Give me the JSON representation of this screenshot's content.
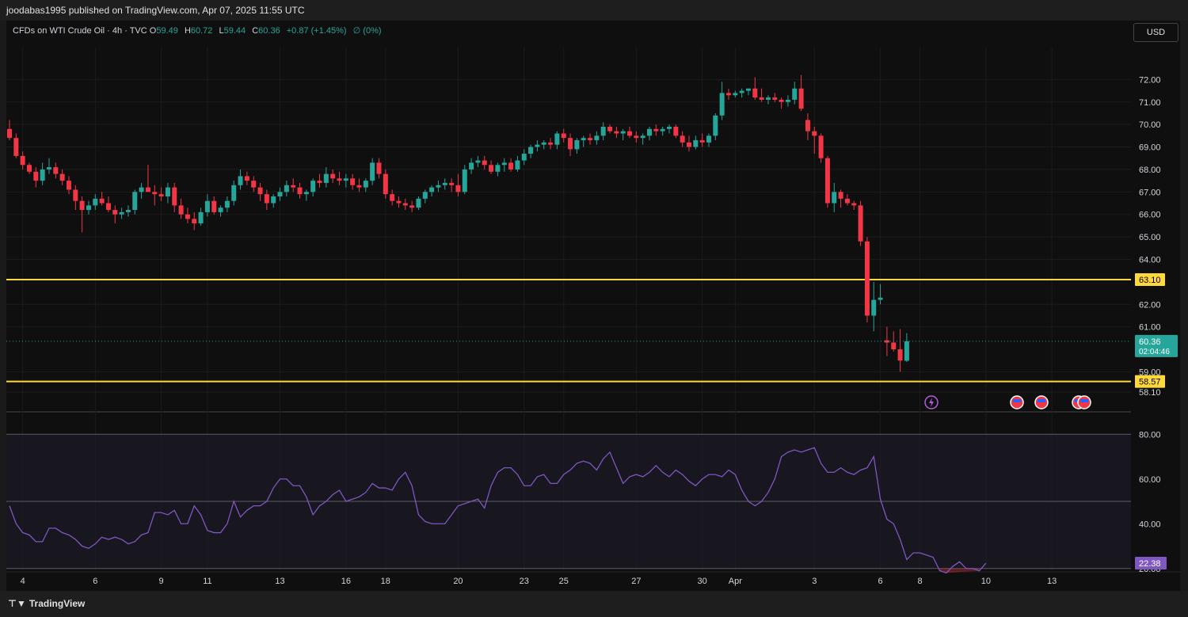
{
  "header": {
    "publisher_text": "joodabas1995 published on TradingView.com, Apr 07, 2025 11:55 UTC"
  },
  "legend": {
    "symbol": "CFDs on WTI Crude Oil · 4h · TVC",
    "open_label": "O",
    "open": "59.49",
    "high_label": "H",
    "high": "60.72",
    "low_label": "L",
    "low": "59.44",
    "close_label": "C",
    "close": "60.36",
    "change": "+0.87 (+1.45%)",
    "extra": "∅ (0%)"
  },
  "currency_button": "USD",
  "footer": {
    "brand": "TradingView",
    "logo_icon": "tradingview-logo-icon"
  },
  "colors": {
    "up": "#26a69a",
    "down": "#f23645",
    "level": "#ffd93b",
    "rsi": "#7e57c2",
    "background": "#0f0f0f"
  },
  "chart_data": [
    {
      "type": "candlestick",
      "symbol": "CFDs on WTI Crude Oil",
      "interval": "4h",
      "ylim": [
        57.5,
        73.0
      ],
      "y_ticks": [
        "72.00",
        "71.00",
        "70.00",
        "69.00",
        "68.00",
        "67.00",
        "66.00",
        "65.00",
        "64.00",
        "62.00",
        "61.00",
        "59.00",
        "58.10"
      ],
      "x_ticks": [
        {
          "label": "4",
          "i": 2
        },
        {
          "label": "6",
          "i": 13
        },
        {
          "label": "9",
          "i": 23
        },
        {
          "label": "11",
          "i": 30
        },
        {
          "label": "13",
          "i": 41
        },
        {
          "label": "16",
          "i": 51
        },
        {
          "label": "18",
          "i": 57
        },
        {
          "label": "20",
          "i": 68
        },
        {
          "label": "23",
          "i": 78
        },
        {
          "label": "25",
          "i": 84
        },
        {
          "label": "27",
          "i": 95
        },
        {
          "label": "30",
          "i": 105
        },
        {
          "label": "Apr",
          "i": 110
        },
        {
          "label": "3",
          "i": 122
        },
        {
          "label": "6",
          "i": 132
        },
        {
          "label": "8",
          "i": 138
        },
        {
          "label": "10",
          "i": 148
        },
        {
          "label": "13",
          "i": 158
        }
      ],
      "horizontal_levels": [
        {
          "value": 63.1,
          "label": "63.10"
        },
        {
          "value": 58.57,
          "label": "58.57"
        }
      ],
      "last_price": {
        "value": 60.36,
        "label": "60.36",
        "countdown": "02:04:46"
      },
      "candles": [
        [
          69.8,
          70.2,
          69.3,
          69.4
        ],
        [
          69.4,
          69.6,
          68.5,
          68.6
        ],
        [
          68.6,
          68.8,
          68.0,
          68.2
        ],
        [
          68.2,
          68.3,
          67.8,
          67.9
        ],
        [
          67.9,
          68.1,
          67.2,
          67.5
        ],
        [
          67.5,
          68.3,
          67.3,
          68.0
        ],
        [
          68.0,
          68.5,
          67.8,
          68.1
        ],
        [
          68.1,
          68.3,
          67.6,
          67.8
        ],
        [
          67.8,
          68.0,
          67.3,
          67.5
        ],
        [
          67.5,
          67.7,
          66.9,
          67.1
        ],
        [
          67.1,
          67.3,
          66.2,
          66.6
        ],
        [
          66.6,
          66.8,
          65.2,
          66.2
        ],
        [
          66.2,
          66.6,
          66.0,
          66.4
        ],
        [
          66.4,
          66.9,
          66.2,
          66.7
        ],
        [
          66.7,
          67.0,
          66.4,
          66.5
        ],
        [
          66.5,
          66.8,
          66.1,
          66.2
        ],
        [
          66.2,
          66.4,
          65.6,
          66.0
        ],
        [
          66.0,
          66.3,
          65.8,
          66.1
        ],
        [
          66.1,
          66.4,
          65.9,
          66.2
        ],
        [
          66.2,
          67.1,
          66.0,
          67.0
        ],
        [
          67.0,
          67.4,
          66.7,
          67.2
        ],
        [
          67.2,
          68.2,
          67.0,
          67.0
        ],
        [
          67.0,
          67.3,
          66.4,
          66.9
        ],
        [
          66.9,
          67.2,
          66.6,
          66.8
        ],
        [
          66.8,
          67.4,
          66.5,
          67.2
        ],
        [
          67.2,
          67.4,
          66.1,
          66.4
        ],
        [
          66.4,
          66.7,
          65.8,
          66.0
        ],
        [
          66.0,
          66.3,
          65.6,
          65.8
        ],
        [
          65.8,
          66.1,
          65.3,
          65.6
        ],
        [
          65.6,
          66.3,
          65.5,
          66.1
        ],
        [
          66.1,
          66.9,
          65.9,
          66.6
        ],
        [
          66.6,
          66.8,
          66.0,
          66.1
        ],
        [
          66.1,
          66.4,
          65.9,
          66.3
        ],
        [
          66.3,
          66.8,
          66.1,
          66.6
        ],
        [
          66.6,
          67.5,
          66.4,
          67.3
        ],
        [
          67.3,
          68.0,
          67.1,
          67.7
        ],
        [
          67.7,
          67.9,
          67.3,
          67.5
        ],
        [
          67.5,
          67.7,
          67.0,
          67.2
        ],
        [
          67.2,
          67.4,
          66.6,
          66.9
        ],
        [
          66.9,
          67.1,
          66.2,
          66.5
        ],
        [
          66.5,
          66.9,
          66.3,
          66.8
        ],
        [
          66.8,
          67.2,
          66.6,
          67.0
        ],
        [
          67.0,
          67.5,
          66.8,
          67.3
        ],
        [
          67.3,
          67.6,
          67.0,
          67.2
        ],
        [
          67.2,
          67.4,
          66.7,
          66.9
        ],
        [
          66.9,
          67.1,
          66.6,
          67.0
        ],
        [
          67.0,
          67.6,
          66.8,
          67.5
        ],
        [
          67.5,
          67.8,
          67.2,
          67.4
        ],
        [
          67.4,
          68.1,
          67.2,
          67.8
        ],
        [
          67.8,
          68.0,
          67.4,
          67.6
        ],
        [
          67.6,
          67.9,
          67.3,
          67.5
        ],
        [
          67.5,
          67.8,
          67.2,
          67.6
        ],
        [
          67.6,
          67.8,
          67.1,
          67.3
        ],
        [
          67.3,
          67.6,
          67.0,
          67.2
        ],
        [
          67.2,
          67.6,
          67.0,
          67.5
        ],
        [
          67.5,
          68.5,
          67.3,
          68.3
        ],
        [
          68.3,
          68.5,
          67.6,
          67.8
        ],
        [
          67.8,
          68.0,
          66.7,
          66.9
        ],
        [
          66.9,
          67.1,
          66.4,
          66.6
        ],
        [
          66.6,
          66.8,
          66.3,
          66.5
        ],
        [
          66.5,
          66.7,
          66.2,
          66.4
        ],
        [
          66.4,
          66.6,
          66.1,
          66.3
        ],
        [
          66.3,
          66.8,
          66.2,
          66.7
        ],
        [
          66.7,
          67.1,
          66.5,
          67.0
        ],
        [
          67.0,
          67.3,
          66.8,
          67.2
        ],
        [
          67.2,
          67.5,
          67.0,
          67.3
        ],
        [
          67.3,
          67.6,
          67.1,
          67.4
        ],
        [
          67.4,
          67.6,
          67.0,
          67.3
        ],
        [
          67.3,
          67.8,
          66.8,
          67.0
        ],
        [
          67.0,
          68.2,
          66.9,
          68.0
        ],
        [
          68.0,
          68.5,
          67.8,
          68.3
        ],
        [
          68.3,
          68.6,
          68.1,
          68.4
        ],
        [
          68.4,
          68.6,
          68.0,
          68.2
        ],
        [
          68.2,
          68.4,
          67.8,
          67.9
        ],
        [
          67.9,
          68.3,
          67.7,
          68.2
        ],
        [
          68.2,
          68.5,
          67.9,
          68.3
        ],
        [
          68.3,
          68.5,
          67.9,
          68.0
        ],
        [
          68.0,
          68.6,
          67.9,
          68.4
        ],
        [
          68.4,
          68.9,
          68.2,
          68.7
        ],
        [
          68.7,
          69.1,
          68.5,
          69.0
        ],
        [
          69.0,
          69.3,
          68.8,
          69.1
        ],
        [
          69.1,
          69.3,
          68.9,
          69.2
        ],
        [
          69.2,
          69.4,
          68.9,
          69.1
        ],
        [
          69.1,
          69.7,
          68.9,
          69.6
        ],
        [
          69.6,
          69.8,
          69.2,
          69.4
        ],
        [
          69.4,
          69.6,
          68.6,
          68.9
        ],
        [
          68.9,
          69.4,
          68.7,
          69.3
        ],
        [
          69.3,
          69.5,
          69.0,
          69.4
        ],
        [
          69.4,
          69.6,
          69.1,
          69.3
        ],
        [
          69.3,
          69.7,
          69.1,
          69.5
        ],
        [
          69.5,
          70.1,
          69.3,
          69.9
        ],
        [
          69.9,
          70.0,
          69.6,
          69.7
        ],
        [
          69.7,
          69.9,
          69.4,
          69.6
        ],
        [
          69.6,
          69.8,
          69.3,
          69.7
        ],
        [
          69.7,
          69.9,
          69.4,
          69.5
        ],
        [
          69.5,
          69.7,
          69.2,
          69.4
        ],
        [
          69.4,
          69.6,
          69.1,
          69.5
        ],
        [
          69.5,
          69.9,
          69.3,
          69.8
        ],
        [
          69.8,
          70.0,
          69.5,
          69.7
        ],
        [
          69.7,
          69.9,
          69.5,
          69.8
        ],
        [
          69.8,
          70.0,
          69.6,
          69.9
        ],
        [
          69.9,
          70.0,
          69.4,
          69.5
        ],
        [
          69.5,
          69.7,
          69.0,
          69.2
        ],
        [
          69.2,
          69.5,
          68.8,
          69.0
        ],
        [
          69.0,
          69.5,
          68.9,
          69.3
        ],
        [
          69.3,
          69.6,
          69.0,
          69.2
        ],
        [
          69.2,
          69.6,
          69.0,
          69.5
        ],
        [
          69.5,
          70.5,
          69.3,
          70.4
        ],
        [
          70.4,
          71.9,
          70.2,
          71.4
        ],
        [
          71.4,
          71.6,
          71.1,
          71.3
        ],
        [
          71.3,
          71.5,
          71.2,
          71.4
        ],
        [
          71.4,
          71.6,
          71.2,
          71.5
        ],
        [
          71.5,
          71.6,
          71.3,
          71.6
        ],
        [
          71.6,
          72.1,
          71.1,
          71.2
        ],
        [
          71.2,
          71.6,
          71.0,
          71.1
        ],
        [
          71.1,
          71.3,
          70.9,
          71.2
        ],
        [
          71.2,
          71.4,
          71.0,
          71.1
        ],
        [
          71.1,
          71.2,
          70.7,
          71.0
        ],
        [
          71.0,
          71.3,
          70.8,
          71.1
        ],
        [
          71.1,
          71.9,
          70.9,
          71.6
        ],
        [
          71.6,
          72.2,
          70.6,
          70.7
        ],
        [
          70.2,
          70.5,
          69.3,
          69.7
        ],
        [
          69.7,
          69.9,
          68.7,
          69.5
        ],
        [
          69.5,
          69.6,
          68.3,
          68.5
        ],
        [
          68.5,
          68.6,
          66.3,
          66.5
        ],
        [
          66.5,
          67.4,
          66.1,
          67.0
        ],
        [
          67.0,
          67.1,
          66.3,
          66.7
        ],
        [
          66.7,
          66.9,
          66.4,
          66.5
        ],
        [
          66.5,
          66.6,
          66.2,
          66.4
        ],
        [
          66.4,
          66.6,
          64.6,
          64.8
        ],
        [
          64.8,
          65.0,
          61.2,
          61.5
        ],
        [
          61.5,
          63.0,
          60.8,
          62.2
        ],
        [
          62.2,
          62.9,
          62.0,
          62.3
        ],
        [
          60.4,
          61.0,
          59.7,
          60.3
        ],
        [
          60.3,
          60.8,
          59.9,
          60.0
        ],
        [
          60.0,
          60.9,
          59.0,
          59.5
        ],
        [
          59.49,
          60.72,
          59.44,
          60.36
        ]
      ]
    },
    {
      "type": "line",
      "indicator": "RSI",
      "ylim": [
        10,
        90
      ],
      "y_ticks": [
        "80.00",
        "60.00",
        "40.00",
        "20.00"
      ],
      "bands": [
        80,
        50,
        20
      ],
      "current_value_label": "22.38",
      "values": [
        48,
        40,
        36,
        35,
        32,
        32,
        38,
        38,
        36,
        35,
        33,
        30,
        29,
        31,
        34,
        33,
        34,
        33,
        31,
        32,
        35,
        36,
        45,
        45,
        44,
        46,
        40,
        40,
        48,
        44,
        37,
        36,
        36,
        40,
        50,
        43,
        46,
        48,
        48,
        50,
        56,
        60,
        60,
        57,
        57,
        52,
        44,
        48,
        50,
        53,
        55,
        50,
        51,
        52,
        54,
        58,
        56,
        56,
        55,
        60,
        63,
        57,
        44,
        41,
        40,
        40,
        40,
        44,
        48,
        49,
        50,
        51,
        47,
        57,
        63,
        65,
        65,
        62,
        57,
        57,
        61,
        62,
        58,
        58,
        62,
        64,
        67,
        68,
        67,
        64,
        69,
        72,
        65,
        58,
        61,
        62,
        61,
        63,
        66,
        63,
        61,
        64,
        62,
        59,
        57,
        60,
        62,
        62,
        61,
        64,
        62,
        55,
        50,
        48,
        50,
        54,
        60,
        70,
        72,
        73,
        72,
        73,
        74,
        67,
        63,
        63,
        65,
        63,
        62,
        64,
        65,
        70,
        51,
        42,
        40,
        33,
        24,
        27,
        27,
        26,
        25,
        19,
        18,
        21,
        23,
        20,
        20,
        19,
        22.38
      ]
    }
  ]
}
